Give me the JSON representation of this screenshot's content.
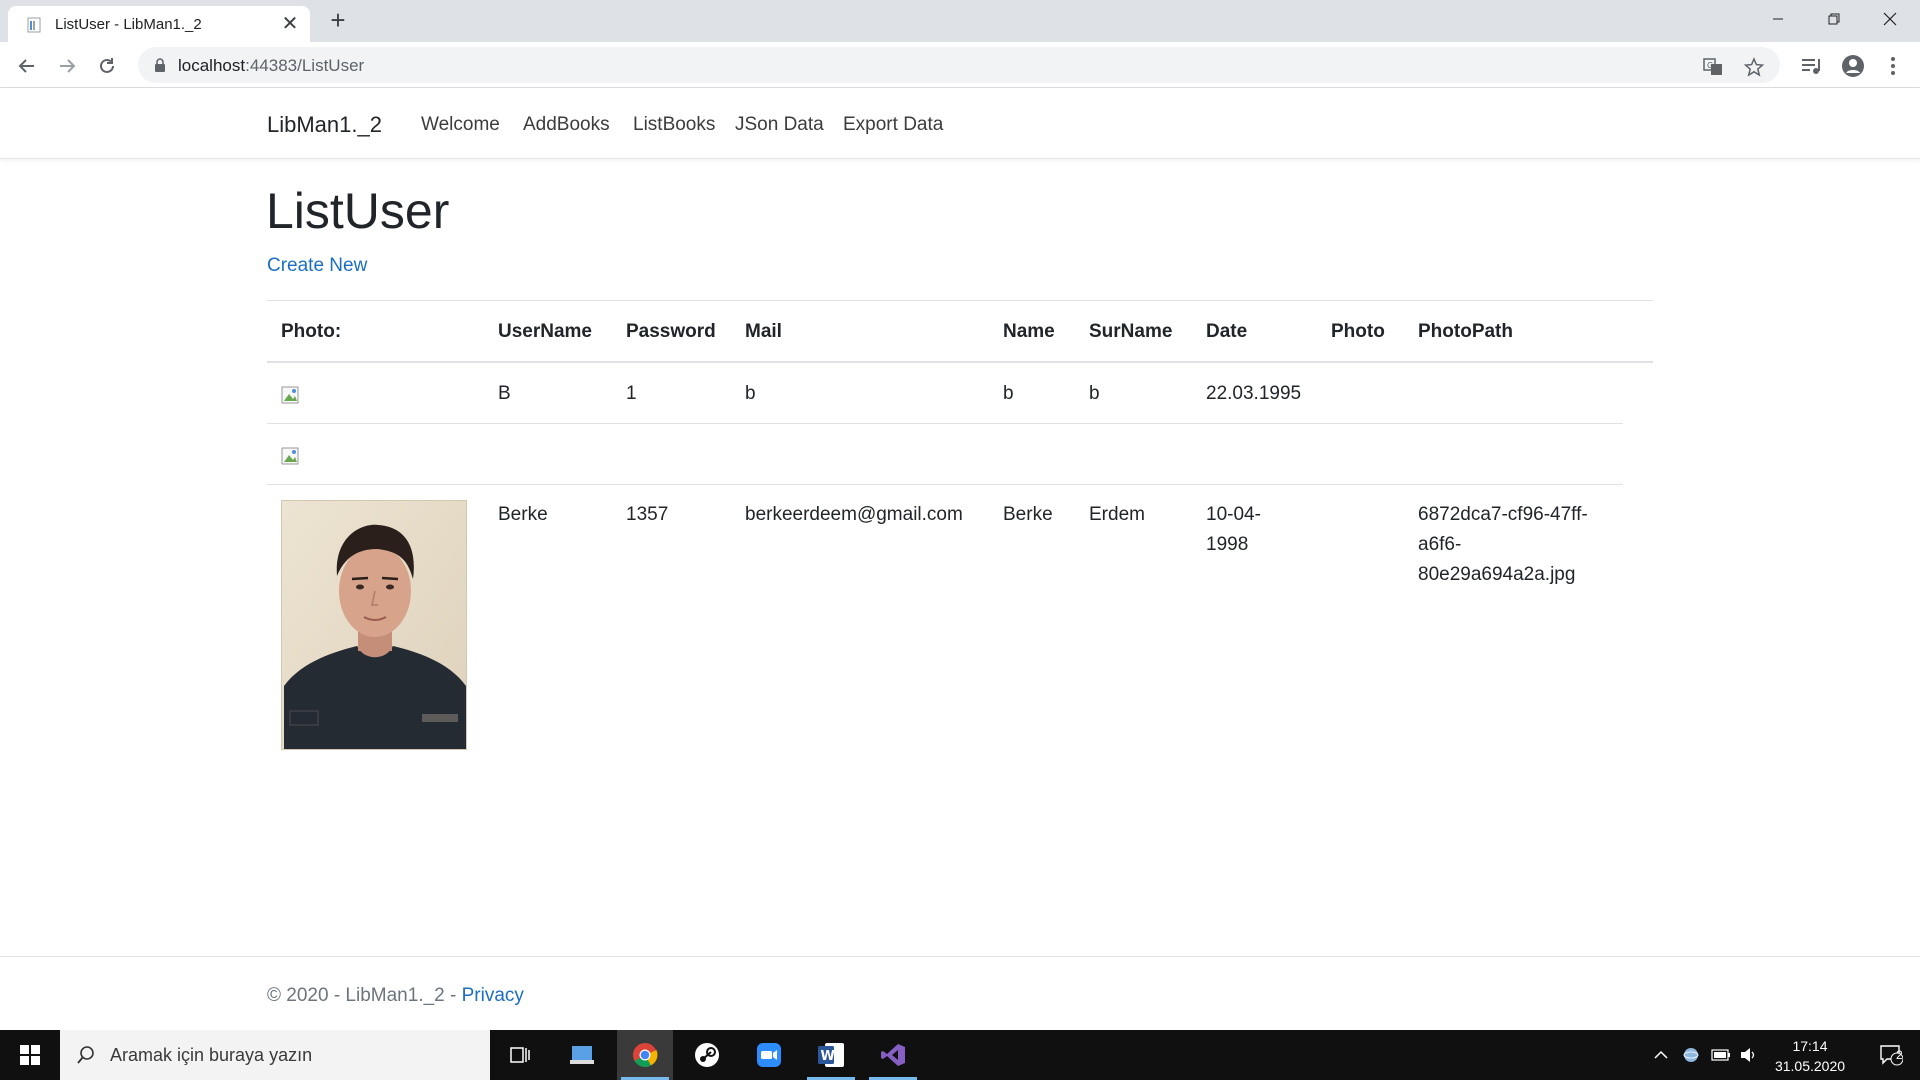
{
  "browser": {
    "tab_title": "ListUser - LibMan1._2",
    "url_host": "localhost",
    "url_port": ":44383",
    "url_path": "/ListUser"
  },
  "navbar": {
    "brand": "LibMan1._2",
    "links": [
      "Welcome",
      "AddBooks",
      "ListBooks",
      "JSon Data",
      "Export Data"
    ]
  },
  "page": {
    "title": "ListUser",
    "create_new": "Create New"
  },
  "table": {
    "headers": [
      "Photo:",
      "UserName",
      "Password",
      "Mail",
      "Name",
      "SurName",
      "Date",
      "Photo",
      "PhotoPath"
    ],
    "rows": [
      {
        "username": "B",
        "password": "1",
        "mail": "b",
        "name": "b",
        "surname": "b",
        "date": "22.03.1995",
        "photopath": ""
      },
      {
        "username": "",
        "password": "",
        "mail": "",
        "name": "",
        "surname": "",
        "date": "",
        "photopath": ""
      },
      {
        "username": "Berke",
        "password": "1357",
        "mail": "berkeerdeem@gmail.com",
        "name": "Berke",
        "surname": "Erdem",
        "date_line1": "10-04-",
        "date_line2": "1998",
        "photopath_line1": "6872dca7-cf96-47ff-",
        "photopath_line2": "a6f6-",
        "photopath_line3": "80e29a694a2a.jpg"
      }
    ]
  },
  "footer": {
    "copyright": "© 2020 - LibMan1._2 - ",
    "privacy": "Privacy"
  },
  "taskbar": {
    "search_placeholder": "Aramak için buraya yazın",
    "time": "17:14",
    "date": "31.05.2020",
    "notification_count": "2"
  },
  "colors": {
    "link": "#1b6ec2",
    "taskbar": "#101010",
    "tabstrip": "#dee1e6"
  },
  "icons": [
    "back-icon",
    "forward-icon",
    "reload-icon",
    "lock-icon",
    "translate-icon",
    "star-icon",
    "media-icon",
    "profile-icon",
    "menu-icon",
    "windows-icon",
    "search-icon",
    "task-view-icon",
    "chrome-icon",
    "steam-icon",
    "zoom-icon",
    "word-icon",
    "visual-studio-icon"
  ]
}
